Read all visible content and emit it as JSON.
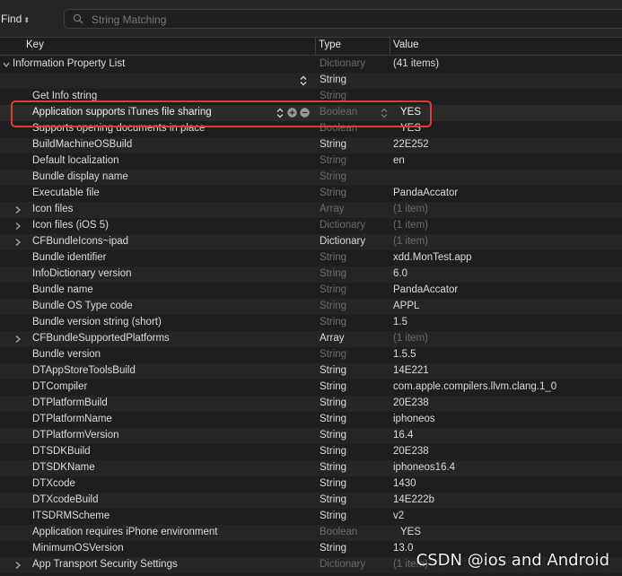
{
  "find": {
    "label": "Find",
    "placeholder": "String Matching"
  },
  "columns": {
    "key": "Key",
    "type": "Type",
    "value": "Value"
  },
  "rows": [
    {
      "key": "Information Property List",
      "type": "Dictionary",
      "value": "(41 items)",
      "type_dim": true,
      "value_dim": false,
      "disclosure": "open",
      "indent": 0
    },
    {
      "key": "",
      "type": "String",
      "value": "",
      "type_dim": false,
      "disclosure": "",
      "indent": 1,
      "stepper": true
    },
    {
      "key": "Get Info string",
      "type": "String",
      "value": "",
      "type_dim": true,
      "disclosure": "",
      "indent": 1
    },
    {
      "key": "Application supports iTunes file sharing",
      "type": "Boolean",
      "value": "YES",
      "type_dim": true,
      "disclosure": "",
      "indent": 1,
      "selected": true
    },
    {
      "key": "Supports opening documents in place",
      "type": "Boolean",
      "value": "YES",
      "type_dim": true,
      "disclosure": "",
      "indent": 1
    },
    {
      "key": "BuildMachineOSBuild",
      "type": "String",
      "value": "22E252",
      "type_dim": false,
      "disclosure": "",
      "indent": 1
    },
    {
      "key": "Default localization",
      "type": "String",
      "value": "en",
      "type_dim": true,
      "disclosure": "",
      "indent": 1
    },
    {
      "key": "Bundle display name",
      "type": "String",
      "value": "",
      "type_dim": true,
      "disclosure": "",
      "indent": 1
    },
    {
      "key": "Executable file",
      "type": "String",
      "value": "PandaAccator",
      "type_dim": true,
      "disclosure": "",
      "indent": 1
    },
    {
      "key": "Icon files",
      "type": "Array",
      "value": "(1 item)",
      "type_dim": true,
      "value_dim": true,
      "disclosure": "closed",
      "indent": 1
    },
    {
      "key": "Icon files (iOS 5)",
      "type": "Dictionary",
      "value": "(1 item)",
      "type_dim": true,
      "value_dim": true,
      "disclosure": "closed",
      "indent": 1
    },
    {
      "key": "CFBundleIcons~ipad",
      "type": "Dictionary",
      "value": "(1 item)",
      "type_dim": false,
      "value_dim": true,
      "disclosure": "closed",
      "indent": 1
    },
    {
      "key": "Bundle identifier",
      "type": "String",
      "value": "xdd.MonTest.app",
      "type_dim": true,
      "disclosure": "",
      "indent": 1
    },
    {
      "key": "InfoDictionary version",
      "type": "String",
      "value": "6.0",
      "type_dim": true,
      "disclosure": "",
      "indent": 1
    },
    {
      "key": "Bundle name",
      "type": "String",
      "value": "PandaAccator",
      "type_dim": true,
      "disclosure": "",
      "indent": 1
    },
    {
      "key": "Bundle OS Type code",
      "type": "String",
      "value": "APPL",
      "type_dim": true,
      "disclosure": "",
      "indent": 1
    },
    {
      "key": "Bundle version string (short)",
      "type": "String",
      "value": "1.5",
      "type_dim": true,
      "disclosure": "",
      "indent": 1
    },
    {
      "key": "CFBundleSupportedPlatforms",
      "type": "Array",
      "value": "(1 item)",
      "type_dim": false,
      "value_dim": true,
      "disclosure": "closed",
      "indent": 1
    },
    {
      "key": "Bundle version",
      "type": "String",
      "value": "1.5.5",
      "type_dim": true,
      "disclosure": "",
      "indent": 1
    },
    {
      "key": "DTAppStoreToolsBuild",
      "type": "String",
      "value": "14E221",
      "type_dim": false,
      "disclosure": "",
      "indent": 1
    },
    {
      "key": "DTCompiler",
      "type": "String",
      "value": "com.apple.compilers.llvm.clang.1_0",
      "type_dim": false,
      "disclosure": "",
      "indent": 1
    },
    {
      "key": "DTPlatformBuild",
      "type": "String",
      "value": "20E238",
      "type_dim": false,
      "disclosure": "",
      "indent": 1
    },
    {
      "key": "DTPlatformName",
      "type": "String",
      "value": "iphoneos",
      "type_dim": false,
      "disclosure": "",
      "indent": 1
    },
    {
      "key": "DTPlatformVersion",
      "type": "String",
      "value": "16.4",
      "type_dim": false,
      "disclosure": "",
      "indent": 1
    },
    {
      "key": "DTSDKBuild",
      "type": "String",
      "value": "20E238",
      "type_dim": false,
      "disclosure": "",
      "indent": 1
    },
    {
      "key": "DTSDKName",
      "type": "String",
      "value": "iphoneos16.4",
      "type_dim": false,
      "disclosure": "",
      "indent": 1
    },
    {
      "key": "DTXcode",
      "type": "String",
      "value": "1430",
      "type_dim": false,
      "disclosure": "",
      "indent": 1
    },
    {
      "key": "DTXcodeBuild",
      "type": "String",
      "value": "14E222b",
      "type_dim": false,
      "disclosure": "",
      "indent": 1
    },
    {
      "key": "ITSDRMScheme",
      "type": "String",
      "value": "v2",
      "type_dim": false,
      "disclosure": "",
      "indent": 1
    },
    {
      "key": "Application requires iPhone environment",
      "type": "Boolean",
      "value": "YES",
      "type_dim": true,
      "disclosure": "",
      "indent": 1
    },
    {
      "key": "MinimumOSVersion",
      "type": "String",
      "value": "13.0",
      "type_dim": false,
      "disclosure": "",
      "indent": 1
    },
    {
      "key": "App Transport Security Settings",
      "type": "Dictionary",
      "value": "(1 item)",
      "type_dim": true,
      "value_dim": true,
      "disclosure": "closed",
      "indent": 1
    }
  ],
  "watermark": "CSDN @ios and Android",
  "colors": {
    "highlight": "#e03a32",
    "background": "#1e1e1e",
    "dim_text": "#6b6b6b"
  },
  "icons": {
    "search": "search-icon",
    "stepper": "up-down-stepper-icon",
    "add": "plus-circle-icon",
    "remove": "minus-circle-icon"
  }
}
